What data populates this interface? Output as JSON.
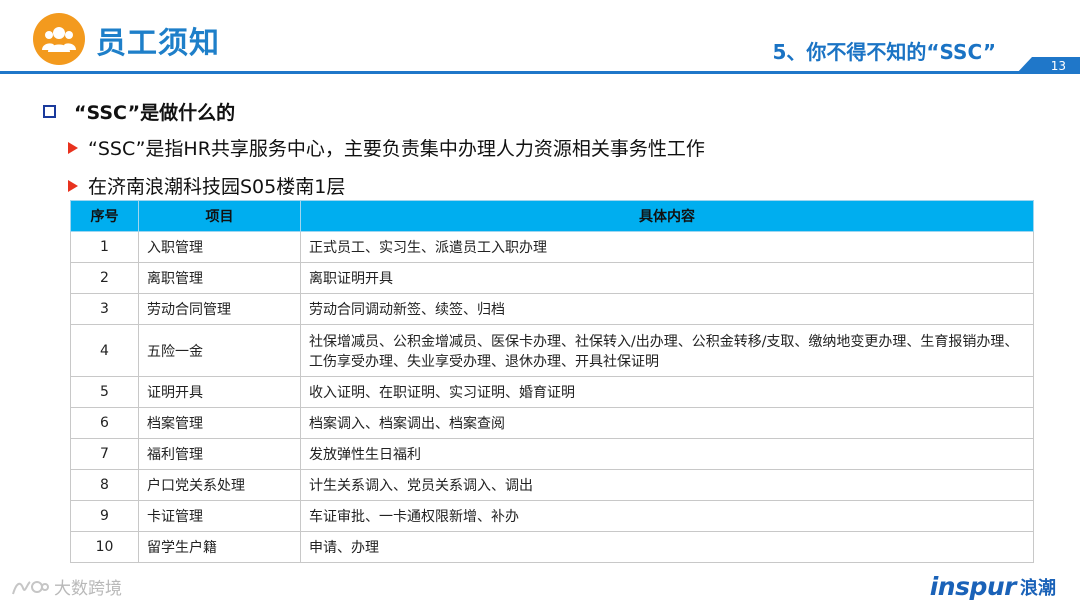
{
  "header": {
    "title": "员工须知",
    "subtitle": "5、你不得不知的“SSC”",
    "page_number": "13"
  },
  "section": {
    "heading": "“SSC”是做什么的",
    "bullets": [
      "“SSC”是指HR共享服务中心，主要负责集中办理人力资源相关事务性工作",
      "在济南浪潮科技园S05楼南1层"
    ]
  },
  "table": {
    "headers": [
      "序号",
      "项目",
      "具体内容"
    ],
    "rows": [
      {
        "num": "1",
        "item": "入职管理",
        "content": "正式员工、实习生、派遣员工入职办理"
      },
      {
        "num": "2",
        "item": "离职管理",
        "content": "离职证明开具"
      },
      {
        "num": "3",
        "item": "劳动合同管理",
        "content": "劳动合同调动新签、续签、归档"
      },
      {
        "num": "4",
        "item": "五险一金",
        "content": "社保增减员、公积金增减员、医保卡办理、社保转入/出办理、公积金转移/支取、缴纳地变更办理、生育报销办理、工伤享受办理、失业享受办理、退休办理、开具社保证明"
      },
      {
        "num": "5",
        "item": "证明开具",
        "content": "收入证明、在职证明、实习证明、婚育证明"
      },
      {
        "num": "6",
        "item": "档案管理",
        "content": "档案调入、档案调出、档案查阅"
      },
      {
        "num": "7",
        "item": "福利管理",
        "content": "发放弹性生日福利"
      },
      {
        "num": "8",
        "item": "户口党关系处理",
        "content": "计生关系调入、党员关系调入、调出"
      },
      {
        "num": "9",
        "item": "卡证管理",
        "content": "车证审批、一卡通权限新增、补办"
      },
      {
        "num": "10",
        "item": "留学生户籍",
        "content": "申请、办理"
      }
    ]
  },
  "footer": {
    "watermark": "大数跨境",
    "brand_en": "inspur",
    "brand_cn": "浪潮"
  },
  "colors": {
    "accent": "#1f77c9",
    "logo": "#f39a1e",
    "table_header": "#00aeef",
    "arrow": "#e8321e"
  }
}
